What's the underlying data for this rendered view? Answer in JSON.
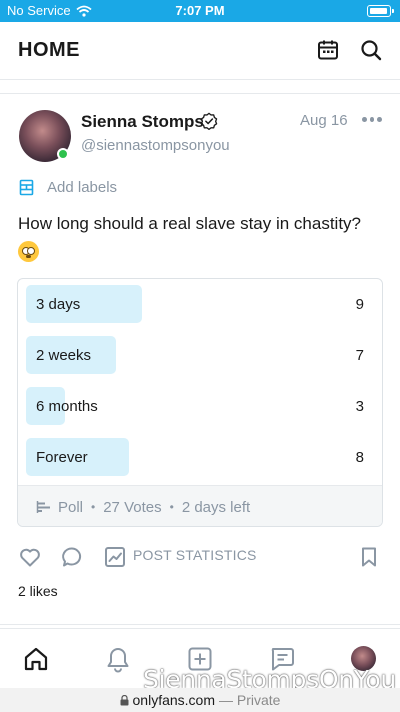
{
  "status_bar": {
    "carrier": "No Service",
    "time": "7:07 PM"
  },
  "header": {
    "title": "HOME"
  },
  "post": {
    "author_name": "Sienna Stomps",
    "handle": "@siennastompsonyou",
    "date": "Aug 16",
    "add_labels": "Add labels",
    "text": "How long should a real slave stay in chastity?",
    "emoji": "face-with-rolling-eyes"
  },
  "poll": {
    "options": [
      {
        "label": "3 days",
        "votes": "9",
        "fraction": 0.333
      },
      {
        "label": "2 weeks",
        "votes": "7",
        "fraction": 0.259
      },
      {
        "label": "6 months",
        "votes": "3",
        "fraction": 0.111
      },
      {
        "label": "Forever",
        "votes": "8",
        "fraction": 0.296
      }
    ],
    "footer": {
      "type": "Poll",
      "votes": "27 Votes",
      "time_left": "2 days left"
    }
  },
  "actions": {
    "statistics_label": "POST STATISTICS",
    "likes": "2 likes"
  },
  "watermark": "SiennaStompsOnYou",
  "url_bar": {
    "domain": "onlyfans.com",
    "mode": "— Private"
  },
  "colors": {
    "accent": "#1aa8e6",
    "poll_bar": "#d7f1fb",
    "muted": "#8a96a3",
    "online": "#2ec14d"
  }
}
